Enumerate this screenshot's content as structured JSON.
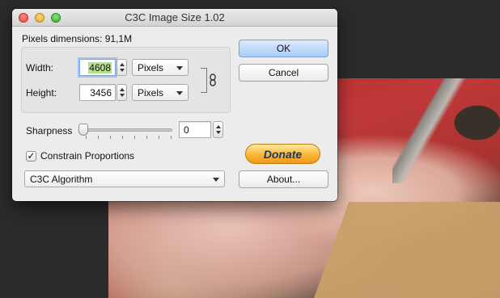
{
  "window": {
    "title": "C3C Image Size 1.02"
  },
  "pixels": {
    "dimensions_label": "Pixels dimensions: 91,1M",
    "width_label": "Width:",
    "width_value": "4608",
    "width_unit": "Pixels",
    "height_label": "Height:",
    "height_value": "3456",
    "height_unit": "Pixels"
  },
  "sharpness": {
    "label": "Sharpness",
    "value": "0",
    "level": 0
  },
  "constrain": {
    "label": "Constrain Proportions",
    "checked": true,
    "checkmark": "✓"
  },
  "algorithm": {
    "selected": "C3C Algorithm"
  },
  "buttons": {
    "ok": "OK",
    "cancel": "Cancel",
    "donate": "Donate",
    "about": "About..."
  },
  "icons": {
    "link": "chain-link-icon"
  }
}
